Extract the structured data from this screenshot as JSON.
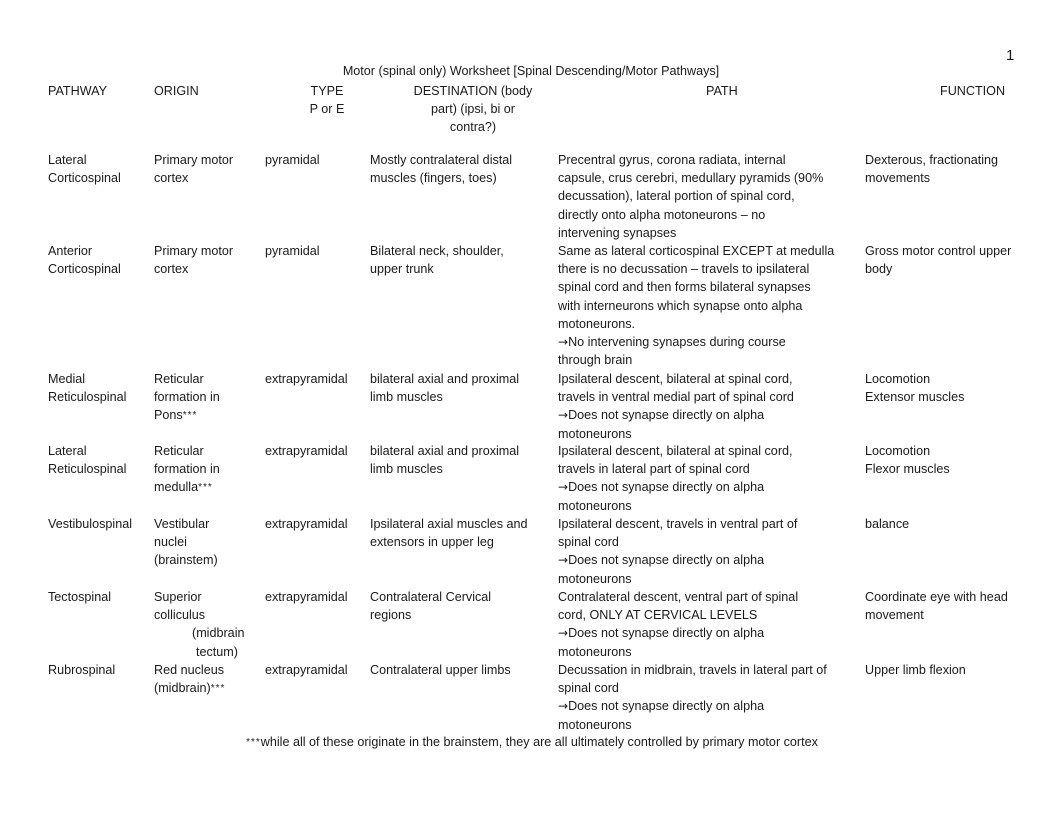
{
  "page_number": "1",
  "title": "Motor (spinal only) Worksheet [Spinal Descending/Motor Pathways]",
  "headers": {
    "pathway": "PATHWAY",
    "origin": "ORIGIN",
    "type_line1": "TYPE",
    "type_line2": "P or E",
    "destination_line1": "DESTINATION (body",
    "destination_line2": "part) (ipsi, bi or",
    "destination_line3": "contra?)",
    "path": "PATH",
    "function": "FUNCTION"
  },
  "rows": [
    {
      "pathway": [
        "Lateral",
        "Corticospinal"
      ],
      "origin": [
        "Primary motor",
        "cortex"
      ],
      "type": "pyramidal",
      "destination": [
        "Mostly contralateral distal",
        "muscles (fingers, toes)"
      ],
      "path": [
        "Precentral gyrus, corona radiata, internal",
        "capsule, crus cerebri, medullary pyramids (90%",
        "decussation), lateral portion of spinal cord,",
        "directly onto alpha motoneurons – no",
        "intervening synapses"
      ],
      "function": [
        "Dexterous, fractionating",
        "movements"
      ]
    },
    {
      "pathway": [
        "Anterior",
        "Corticospinal"
      ],
      "origin": [
        "Primary motor",
        "cortex"
      ],
      "type": "pyramidal",
      "destination": [
        "Bilateral neck, shoulder,",
        "upper trunk"
      ],
      "path": [
        "Same as lateral corticospinal EXCEPT at medulla",
        "there is no decussation – travels to ipsilateral",
        "spinal cord and then forms bilateral synapses",
        "with interneurons which synapse onto alpha",
        "motoneurons."
      ],
      "path_note": [
        "No intervening synapses during course",
        "through brain"
      ],
      "function": [
        "Gross motor control upper",
        "body"
      ]
    },
    {
      "pathway": [
        "Medial",
        "Reticulospinal"
      ],
      "origin": [
        "Reticular",
        "formation in",
        "Pons"
      ],
      "origin_marker": "***",
      "type": "extrapyramidal",
      "destination": [
        "bilateral axial and proximal",
        "limb muscles"
      ],
      "path": [
        "Ipsilateral descent, bilateral at spinal cord,",
        "travels in ventral medial part of spinal cord"
      ],
      "path_note": [
        "Does not synapse directly on alpha",
        "motoneurons"
      ],
      "function": [
        "Locomotion",
        "Extensor muscles"
      ]
    },
    {
      "pathway": [
        "Lateral",
        "Reticulospinal"
      ],
      "origin": [
        "Reticular",
        "formation in",
        "medulla"
      ],
      "origin_marker": "***",
      "type": "extrapyramidal",
      "destination": [
        "bilateral axial and proximal",
        "limb muscles"
      ],
      "path": [
        "Ipsilateral descent, bilateral at spinal cord,",
        "travels in lateral part of spinal cord"
      ],
      "path_note": [
        "Does not synapse directly on alpha",
        "motoneurons"
      ],
      "function": [
        "Locomotion",
        "Flexor muscles"
      ]
    },
    {
      "pathway": [
        "Vestibulospinal"
      ],
      "origin": [
        "Vestibular",
        "nuclei",
        "(brainstem)"
      ],
      "type": "extrapyramidal",
      "destination": [
        "Ipsilateral axial muscles and",
        "extensors in upper leg"
      ],
      "path": [
        "Ipsilateral descent, travels in ventral part of",
        "spinal cord"
      ],
      "path_note": [
        "Does not synapse directly on alpha",
        "motoneurons"
      ],
      "function": [
        "balance"
      ]
    },
    {
      "pathway": [
        "Tectospinal"
      ],
      "origin": [
        "Superior",
        "colliculus",
        "(midbrain",
        "tectum)"
      ],
      "type": "extrapyramidal",
      "destination": [
        "Contralateral Cervical",
        "regions"
      ],
      "path": [
        "Contralateral descent, ventral part of spinal",
        "cord, ONLY AT CERVICAL LEVELS"
      ],
      "path_note": [
        "Does not synapse directly on alpha",
        "motoneurons"
      ],
      "function": [
        "Coordinate eye with head",
        "movement"
      ]
    },
    {
      "pathway": [
        "Rubrospinal"
      ],
      "origin": [
        "Red nucleus",
        "(midbrain)"
      ],
      "origin_marker": "***",
      "type": "extrapyramidal",
      "destination": [
        "Contralateral upper limbs"
      ],
      "path": [
        "Decussation in midbrain, travels in lateral part of",
        "spinal cord"
      ],
      "path_note": [
        "Does not synapse directly on alpha",
        "motoneurons"
      ],
      "function": [
        "Upper limb flexion"
      ]
    }
  ],
  "arrow_glyph": "→",
  "footnote_marker": "***",
  "footnote": "while all of these originate in the brainstem, they are all ultimately controlled by primary motor cortex"
}
